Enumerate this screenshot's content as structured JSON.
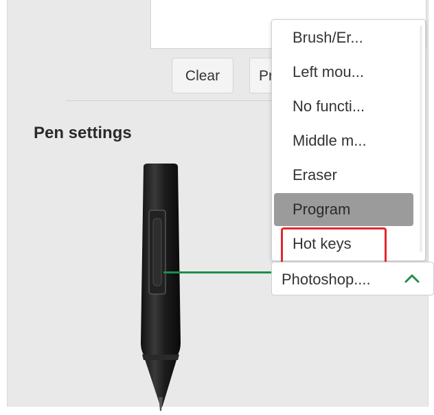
{
  "buttons": {
    "clear_label": "Clear",
    "preview_label": "Pr"
  },
  "pen_settings": {
    "title": "Pen settings"
  },
  "dropdown": {
    "options": [
      "Brush/Er...",
      "Left mou...",
      "No functi...",
      "Middle m...",
      "Eraser",
      "Program",
      "Hot keys"
    ],
    "hovered_option": "Program",
    "highlighted_option": "Hot keys",
    "selected_value": "Photoshop....",
    "chevron_icon": "chevron-up-icon"
  },
  "colors": {
    "connector": "#1a8f4a",
    "highlight_box": "#e3262c",
    "chevron": "#1a8f4a",
    "hover_bg": "#9b9b9b"
  }
}
